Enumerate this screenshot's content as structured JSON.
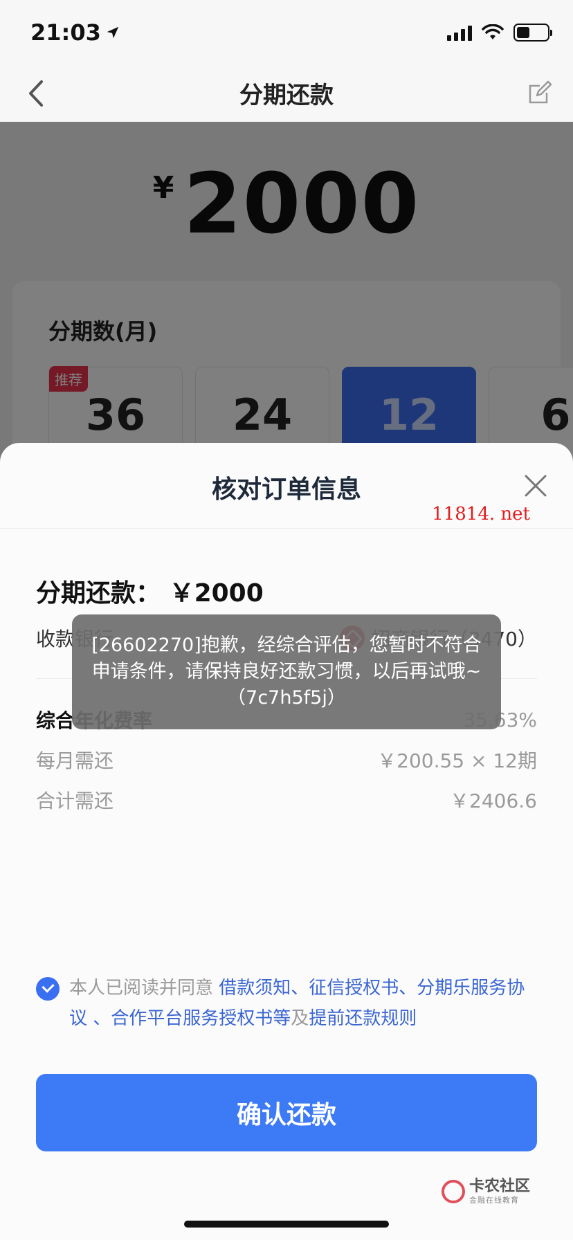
{
  "status_bar": {
    "time": "21:03"
  },
  "nav": {
    "title": "分期还款"
  },
  "background": {
    "currency": "¥",
    "amount": "2000",
    "period_title": "分期数(月)",
    "recommend_badge": "推荐",
    "options": [
      "36",
      "24",
      "12",
      "6"
    ],
    "selected_option": "12"
  },
  "sheet": {
    "title": "核对订单信息",
    "watermark_site": "11814. net",
    "repay_label": "分期还款：",
    "repay_amount": "￥2000",
    "bank_label": "收款银行",
    "bank_value": "招商银行（3470）",
    "rate_label": "综合年化费率",
    "rate_value": "35.63%",
    "monthly_label": "每月需还",
    "monthly_value": "￥200.55 × 12期",
    "total_label": "合计需还",
    "total_value": "￥2406.6",
    "agree_prefix": "本人已阅读并同意 ",
    "agree_links": "借款须知、征信授权书、分期乐服务协议 、合作平台服务授权书等",
    "agree_middle": "及",
    "agree_link_last": "提前还款规则",
    "confirm_button": "确认还款"
  },
  "toast": {
    "message": "[26602270]抱歉，经综合评估，您暂时不符合申请条件，请保持良好还款习惯，以后再试哦~ （7c7h5f5j）"
  },
  "brand_watermark": {
    "name": "卡农社区",
    "sub": "金融在线教育"
  },
  "colors": {
    "primary": "#3d7af6",
    "link": "#3b66d1",
    "badge": "#e8334a",
    "bank": "#c8161d",
    "watermark": "#e21c1c"
  }
}
